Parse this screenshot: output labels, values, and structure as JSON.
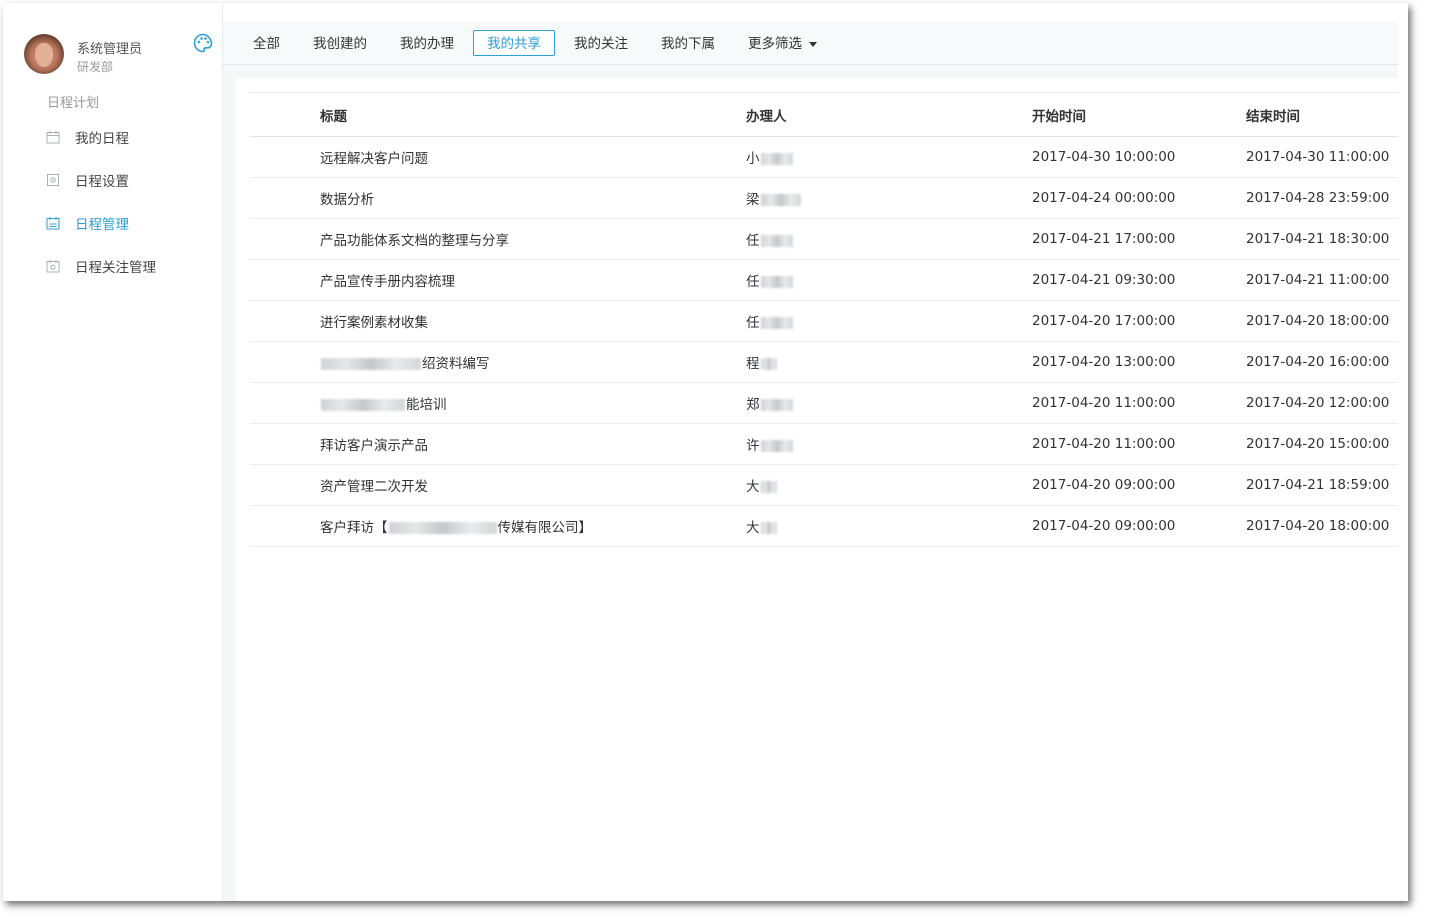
{
  "user": {
    "name": "系统管理员",
    "dept": "研发部"
  },
  "sidebar": {
    "section_title": "日程计划",
    "items": [
      {
        "label": "我的日程",
        "icon": "calendar-icon",
        "active": false
      },
      {
        "label": "日程设置",
        "icon": "calendar-settings-icon",
        "active": false
      },
      {
        "label": "日程管理",
        "icon": "calendar-manage-icon",
        "active": true
      },
      {
        "label": "日程关注管理",
        "icon": "calendar-follow-icon",
        "active": false
      }
    ]
  },
  "tabs": [
    {
      "label": "全部"
    },
    {
      "label": "我创建的"
    },
    {
      "label": "我的办理"
    },
    {
      "label": "我的共享",
      "active": true
    },
    {
      "label": "我的关注"
    },
    {
      "label": "我的下属"
    },
    {
      "label": "更多筛选"
    }
  ],
  "table": {
    "headers": [
      "标题",
      "办理人",
      "开始时间",
      "结束时间"
    ],
    "rows": [
      {
        "title": "远程解决客户问题",
        "handler": "小",
        "start": "2017-04-30 10:00:00",
        "end": "2017-04-30 11:00:00"
      },
      {
        "title": "数据分析",
        "handler": "梁",
        "start": "2017-04-24 00:00:00",
        "end": "2017-04-28 23:59:00"
      },
      {
        "title": "产品功能体系文档的整理与分享",
        "handler": "任",
        "start": "2017-04-21 17:00:00",
        "end": "2017-04-21 18:30:00"
      },
      {
        "title": "产品宣传手册内容梳理",
        "handler": "任",
        "start": "2017-04-21 09:30:00",
        "end": "2017-04-21 11:00:00"
      },
      {
        "title": "进行案例素材收集",
        "handler": "任",
        "start": "2017-04-20 17:00:00",
        "end": "2017-04-20 18:00:00"
      },
      {
        "title_suffix": "绍资料编写",
        "handler": "程",
        "start": "2017-04-20 13:00:00",
        "end": "2017-04-20 16:00:00"
      },
      {
        "title_suffix": "能培训",
        "handler": "郑",
        "start": "2017-04-20 11:00:00",
        "end": "2017-04-20 12:00:00"
      },
      {
        "title": "拜访客户演示产品",
        "handler": "许",
        "start": "2017-04-20 11:00:00",
        "end": "2017-04-20 15:00:00"
      },
      {
        "title": "资产管理二次开发",
        "handler": "大",
        "start": "2017-04-20 09:00:00",
        "end": "2017-04-21 18:59:00"
      },
      {
        "title_prefix": "客户拜访【",
        "title_suffix": "传媒有限公司】",
        "handler": "大",
        "start": "2017-04-20 09:00:00",
        "end": "2017-04-20 18:00:00"
      }
    ]
  },
  "colors": {
    "accent": "#2e9fd8",
    "text": "#333333",
    "muted": "#999999"
  }
}
